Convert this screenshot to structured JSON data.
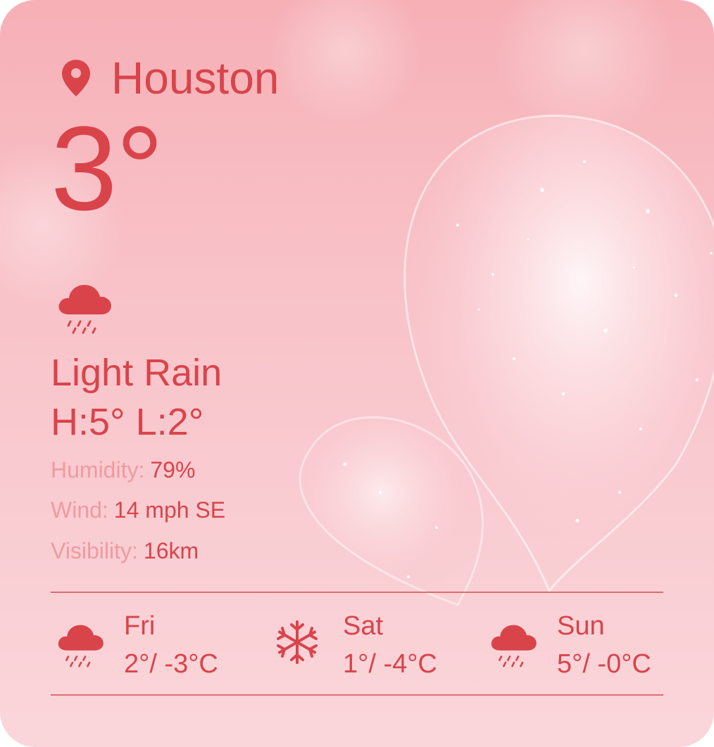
{
  "location": {
    "city": "Houston",
    "icon": "location-pin-icon"
  },
  "current": {
    "temperature": "3°",
    "condition": "Light Rain",
    "condition_icon": "cloud-rain-icon",
    "high_low": "H:5° L:2°"
  },
  "details": {
    "humidity": {
      "label": "Humidity:",
      "value": "79%"
    },
    "wind": {
      "label": "Wind:",
      "value": "14 mph SE"
    },
    "visibility": {
      "label": "Visibility:",
      "value": "16km"
    }
  },
  "forecast": [
    {
      "day": "Fri",
      "range": "2°/ -3°C",
      "icon": "cloud-rain-icon"
    },
    {
      "day": "Sat",
      "range": "1°/ -4°C",
      "icon": "snowflake-icon"
    },
    {
      "day": "Sun",
      "range": "5°/ -0°C",
      "icon": "cloud-rain-icon"
    }
  ],
  "colors": {
    "accent": "#d9444b",
    "label": "#ef9aa0",
    "background_top": "#f6b0b6",
    "background_bottom": "#fad6da"
  }
}
